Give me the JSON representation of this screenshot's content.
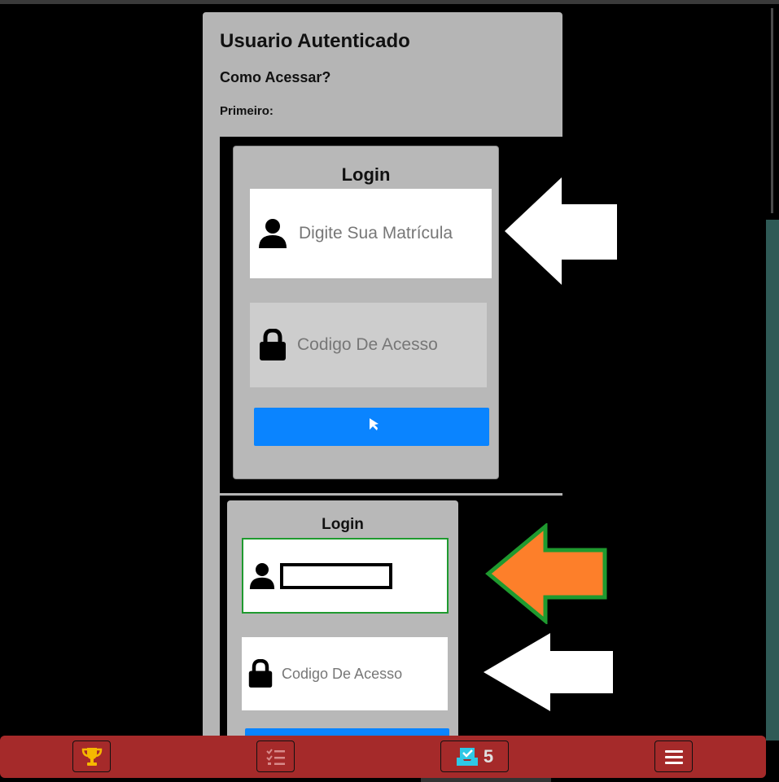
{
  "card": {
    "title": "Usuario Autenticado",
    "subtitle": "Como Acessar?",
    "step": "Primeiro:"
  },
  "screenshot1": {
    "login_title": "Login",
    "matricula_placeholder": "Digite Sua Matrícula",
    "codigo_placeholder": "Codigo De Acesso",
    "arrow_color": "#ffffff"
  },
  "screenshot2": {
    "login_title": "Login",
    "codigo_placeholder": "Codigo De Acesso",
    "highlight_arrow_color": "#fd7f2a",
    "highlight_border_color": "#1f9a2f",
    "arrow_color": "#ffffff"
  },
  "bottom_nav": {
    "background": "#a52a2a",
    "items": [
      {
        "icon": "trophy-icon",
        "color": "#f5b800"
      },
      {
        "icon": "checklist-icon",
        "color": "#d88a8a"
      },
      {
        "icon": "inbox-check-icon",
        "color": "#2ec8e6",
        "badge": "5"
      },
      {
        "icon": "hamburger-menu-icon",
        "color": "#ffffff"
      }
    ]
  }
}
